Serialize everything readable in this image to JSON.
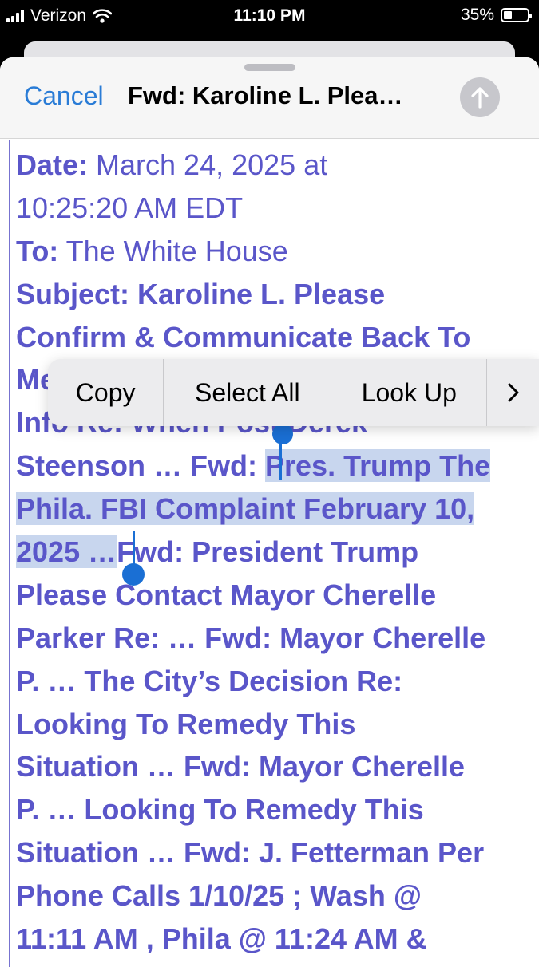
{
  "status_bar": {
    "carrier": "Verizon",
    "time": "11:10 PM",
    "battery": "35%"
  },
  "compose": {
    "cancel_label": "Cancel",
    "title": "Fwd: Karoline L. Plea…",
    "send_icon": "arrow-up-icon"
  },
  "body": {
    "lines": [
      [
        {
          "text": "Date:",
          "bold": true
        },
        {
          "text": " March 24, 2025 at",
          "bold": false
        }
      ],
      [
        {
          "text": "10:25:20 AM EDT",
          "bold": false
        }
      ],
      [
        {
          "text": "To:",
          "bold": true
        },
        {
          "text": " The White House",
          "bold": false
        }
      ],
      [
        {
          "text": "Subject: Karoline L. Please",
          "bold": true
        }
      ],
      [
        {
          "text": "Confirm & Communicate Back To",
          "bold": true
        }
      ],
      [
        {
          "text": "Me",
          "bold": true
        }
      ],
      [
        {
          "text": "Info Re: When Post Derek",
          "bold": true
        }
      ],
      [
        {
          "text": "Steenson … Fwd: ",
          "bold": true
        },
        {
          "text": "Pres. Trump The",
          "bold": true,
          "selected": true
        }
      ],
      [
        {
          "text": "Phila. FBI Complaint February 10,",
          "bold": true,
          "selected": true
        }
      ],
      [
        {
          "text": "2025 …",
          "bold": true,
          "selected": true
        },
        {
          "text": "Fwd: President Trump",
          "bold": true
        }
      ],
      [
        {
          "text": "Please Contact Mayor Cherelle",
          "bold": true
        }
      ],
      [
        {
          "text": "Parker Re: … Fwd: Mayor Cherelle",
          "bold": true
        }
      ],
      [
        {
          "text": "P. … The City’s Decision Re:",
          "bold": true
        }
      ],
      [
        {
          "text": "Looking To Remedy This",
          "bold": true
        }
      ],
      [
        {
          "text": "Situation … Fwd: Mayor Cherelle",
          "bold": true
        }
      ],
      [
        {
          "text": "P. … Looking To Remedy This",
          "bold": true
        }
      ],
      [
        {
          "text": "Situation … Fwd: J. Fetterman Per",
          "bold": true
        }
      ],
      [
        {
          "text": "Phone Calls 1/10/25 ; Wash @",
          "bold": true
        }
      ],
      [
        {
          "text": "11:11 AM , Phila @ 11:24 AM &",
          "bold": true
        }
      ]
    ]
  },
  "context_menu": {
    "items": [
      "Copy",
      "Select All",
      "Look Up"
    ],
    "more_icon": "chevron-right-icon"
  }
}
